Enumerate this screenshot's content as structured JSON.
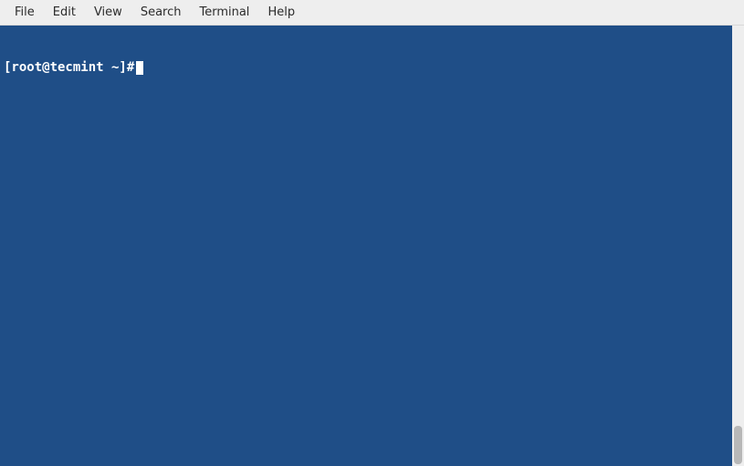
{
  "menubar": {
    "items": [
      {
        "label": "File"
      },
      {
        "label": "Edit"
      },
      {
        "label": "View"
      },
      {
        "label": "Search"
      },
      {
        "label": "Terminal"
      },
      {
        "label": "Help"
      }
    ]
  },
  "terminal": {
    "prompt": "[root@tecmint ~]#",
    "colors": {
      "background": "#1f4e87",
      "foreground": "#ffffff"
    }
  }
}
